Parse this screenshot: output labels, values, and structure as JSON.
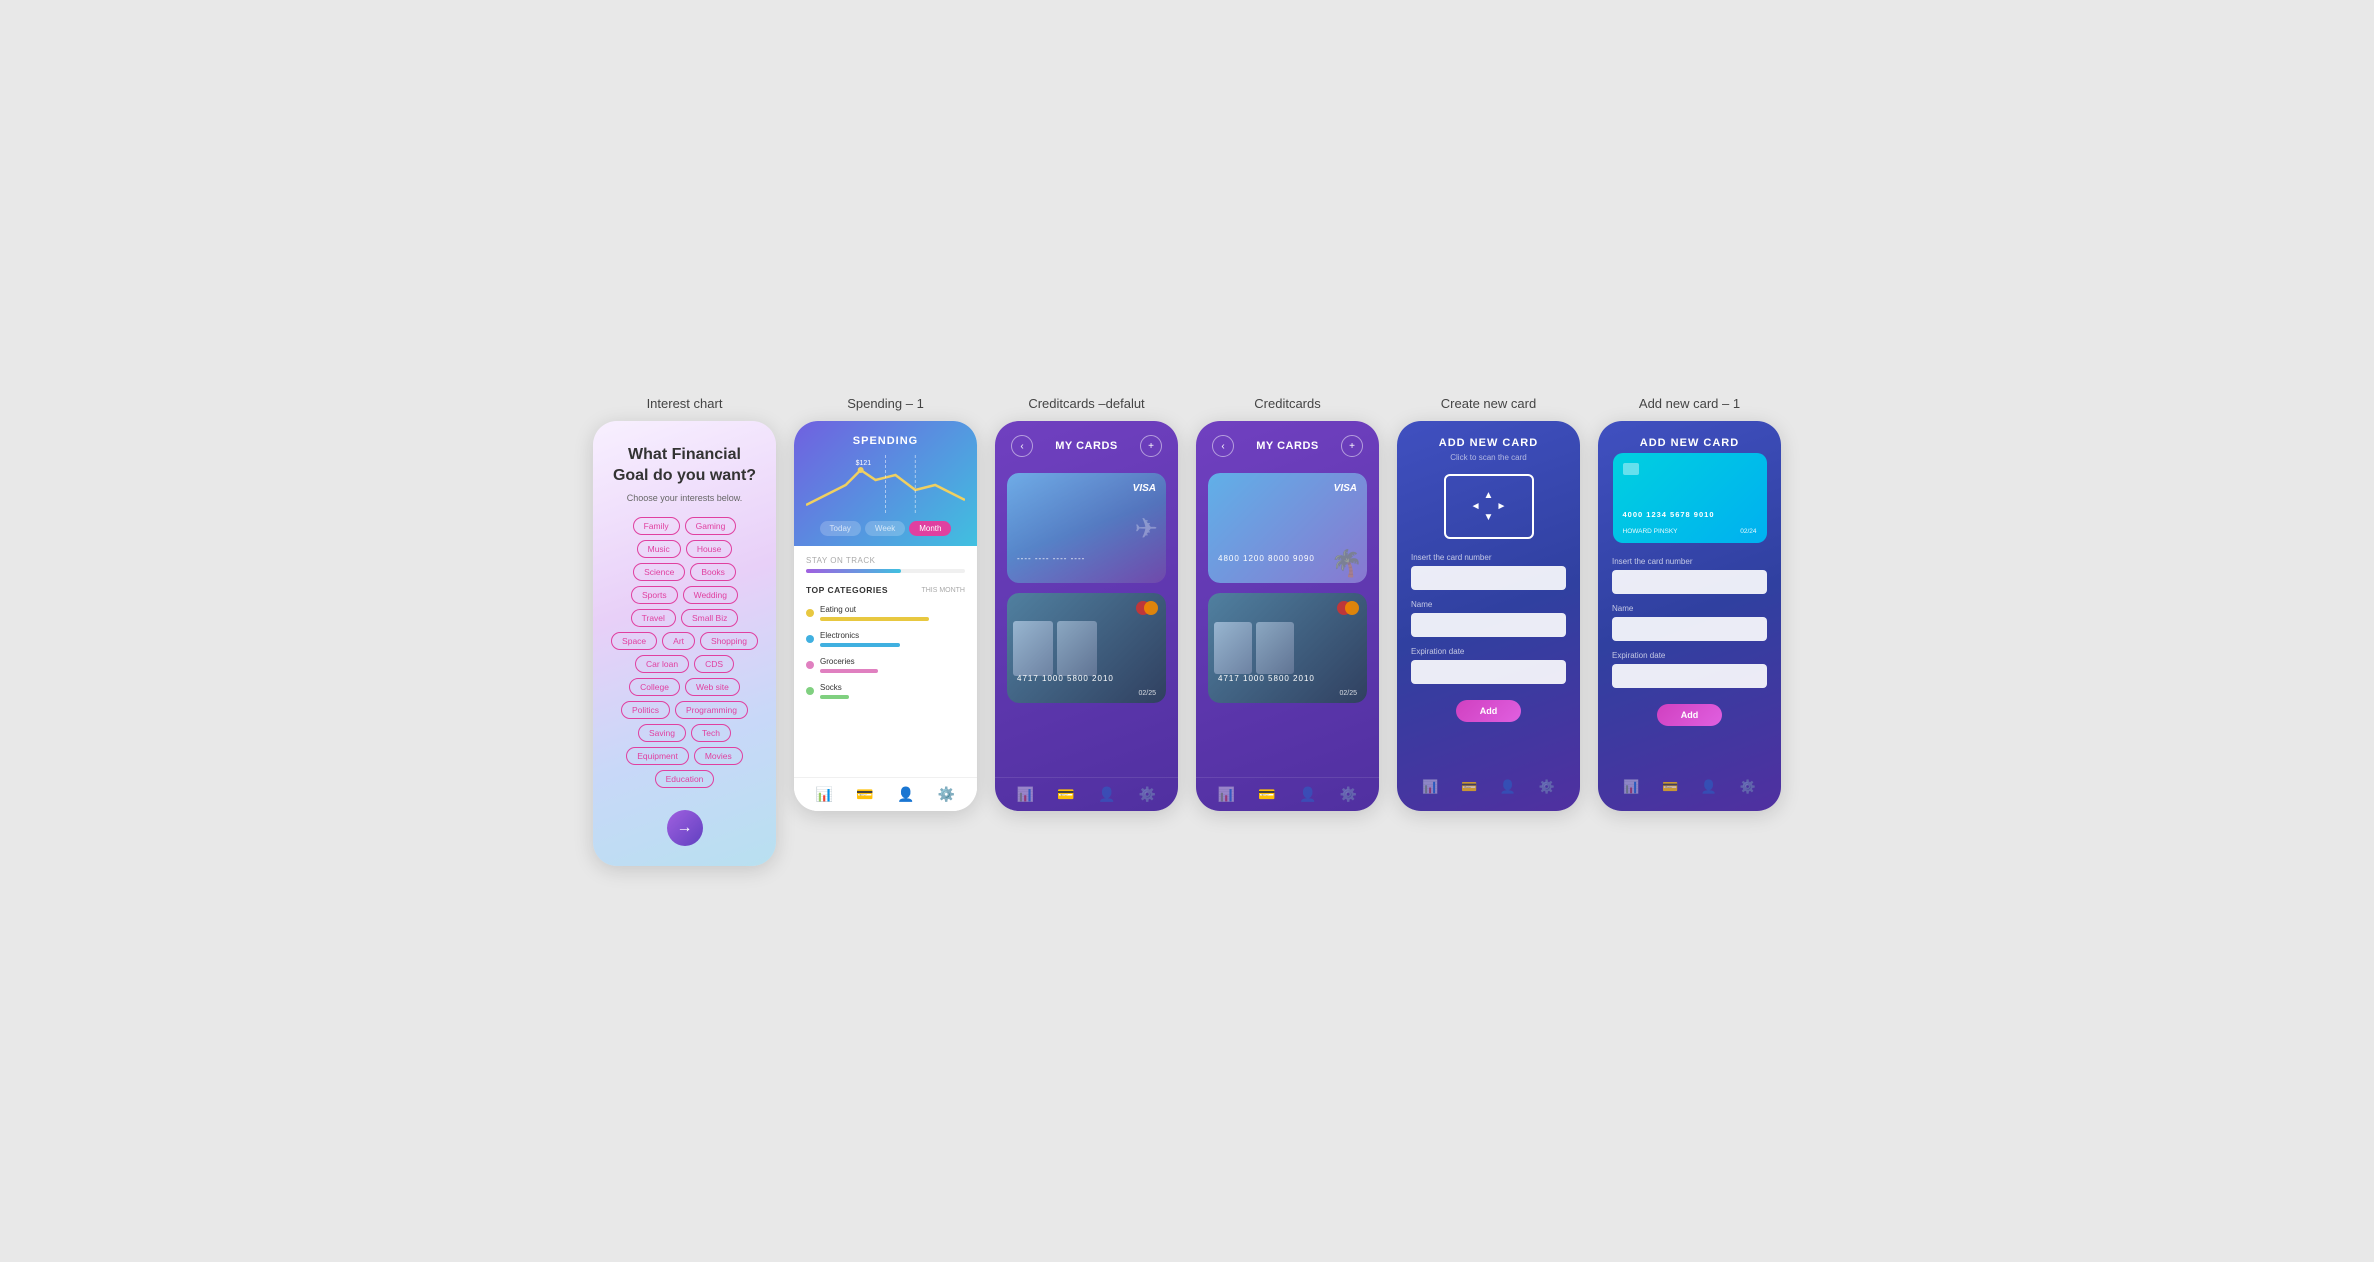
{
  "screens": [
    {
      "id": "interest-chart",
      "title": "Interest chart",
      "heading": "What Financial Goal do you want?",
      "subtitle": "Choose your interests below.",
      "tags": [
        "Family",
        "Gaming",
        "Music",
        "House",
        "Science",
        "Books",
        "Sports",
        "Wedding",
        "Travel",
        "Small Biz",
        "Space",
        "Art",
        "Shopping",
        "Car loan",
        "CDS",
        "College",
        "Web site",
        "Politics",
        "Programming",
        "Saving",
        "Tech",
        "Equipment",
        "Movies",
        "Education"
      ],
      "arrow_label": "→"
    },
    {
      "id": "spending-1",
      "title": "Spending – 1",
      "header_title": "SPENDING",
      "tabs": [
        "Today",
        "Week",
        "Month"
      ],
      "active_tab": "Month",
      "stay_on_track": "STAY ON TRACK",
      "top_categories_label": "TOP CATEGORIES",
      "this_month": "THIS MONTH",
      "categories": [
        {
          "name": "Eating out",
          "color": "#e8c840",
          "bar_width": "75%"
        },
        {
          "name": "Electronics",
          "color": "#40b0e0",
          "bar_width": "55%"
        },
        {
          "name": "Groceries",
          "color": "#e080c0",
          "bar_width": "40%"
        },
        {
          "name": "Socks",
          "color": "#80d080",
          "bar_width": "20%"
        }
      ]
    },
    {
      "id": "creditcards-default",
      "title": "Creditcards –defalut",
      "header_title": "MY CARDS",
      "cards": [
        {
          "number": "---- ---- ---- ----",
          "type": "visa",
          "style": "travel"
        },
        {
          "number": "4717 1000 5800 2010",
          "type": "mastercard",
          "style": "dark",
          "expiry": "02/25"
        }
      ]
    },
    {
      "id": "creditcards",
      "title": "Creditcards",
      "header_title": "MY CARDS",
      "cards": [
        {
          "number": "4800 1200 8000 9090",
          "type": "visa",
          "style": "travel"
        },
        {
          "number": "4717 1000 5800 2010",
          "type": "mastercard",
          "style": "dark",
          "expiry": "02/25"
        }
      ]
    },
    {
      "id": "create-new-card",
      "title": "Create new card",
      "header_title": "ADD NEW CARD",
      "scan_label": "Click to scan the card",
      "fields": [
        {
          "label": "Insert the card number",
          "placeholder": ""
        },
        {
          "label": "Name",
          "placeholder": ""
        },
        {
          "label": "Expiration date",
          "placeholder": ""
        }
      ],
      "add_btn": "Add"
    },
    {
      "id": "add-new-card-1",
      "title": "Add new card – 1",
      "header_title": "ADD NEW CARD",
      "card": {
        "number": "4000 1234 5678 9010",
        "name": "HOWARD PINSKY",
        "expiry": "02/24"
      },
      "fields": [
        {
          "label": "Insert the card number",
          "placeholder": ""
        },
        {
          "label": "Name",
          "placeholder": ""
        },
        {
          "label": "Expiration date",
          "placeholder": ""
        }
      ],
      "add_btn": "Add"
    }
  ]
}
